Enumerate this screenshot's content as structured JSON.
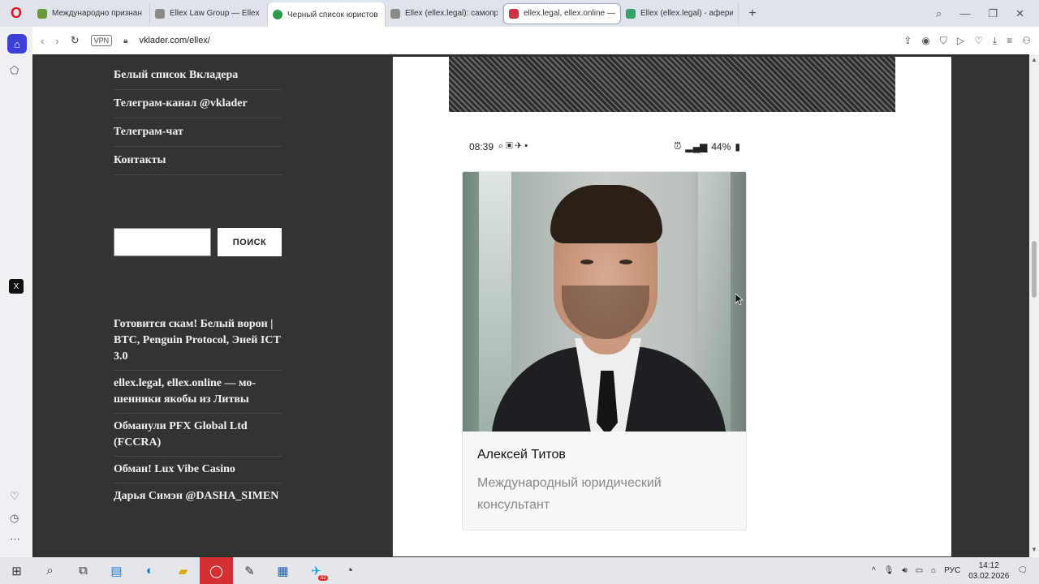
{
  "browser": {
    "tabs": [
      {
        "title": "Международно признан",
        "color": "#6b9a3a",
        "active": false
      },
      {
        "title": "Ellex Law Group — Ellex Lo",
        "color": "#8a8a8a",
        "active": false
      },
      {
        "title": "Черный список юристов",
        "color": "#2e9b4c",
        "active": true
      },
      {
        "title": "Ellex (ellex.legal): самопро",
        "color": "#8a8a8a",
        "active": false
      },
      {
        "title": "ellex.legal, ellex.online —",
        "color": "#cc3344",
        "active": false,
        "selected": true
      },
      {
        "title": "Ellex (ellex.legal) - аферис",
        "color": "#38a169",
        "active": false
      }
    ],
    "url": "vklader.com/ellex/",
    "vpn_label": "VPN"
  },
  "menu": {
    "items": [
      {
        "label": "Белый список Вкладера"
      },
      {
        "label": "Телеграм-канал @vklader"
      },
      {
        "label": "Телеграм-чат"
      },
      {
        "label": "Контакты"
      }
    ]
  },
  "search": {
    "button_label": "ПОИСК",
    "value": ""
  },
  "recent": {
    "items": [
      {
        "label": "Готовится скам! Белый ворон | BTC, Penguin Protocol, Эней ICT 3.0"
      },
      {
        "label": "ellex.legal, ellex.online — мо­шенники якобы из Литвы"
      },
      {
        "label": "Обманули PFX Global Ltd (FCCRA)"
      },
      {
        "label": "Обман! Lux Vibe Casino"
      },
      {
        "label": "Дарья Симэн @DASHA_SIMEN"
      }
    ]
  },
  "phone_status": {
    "time": "08:39",
    "battery": "44%"
  },
  "card": {
    "name": "Алексей Титов",
    "role": "Международный юридический консультант"
  },
  "taskbar": {
    "language": "РУС",
    "time": "14:12",
    "date": "03.02.2026",
    "telegram_badge": "32"
  }
}
